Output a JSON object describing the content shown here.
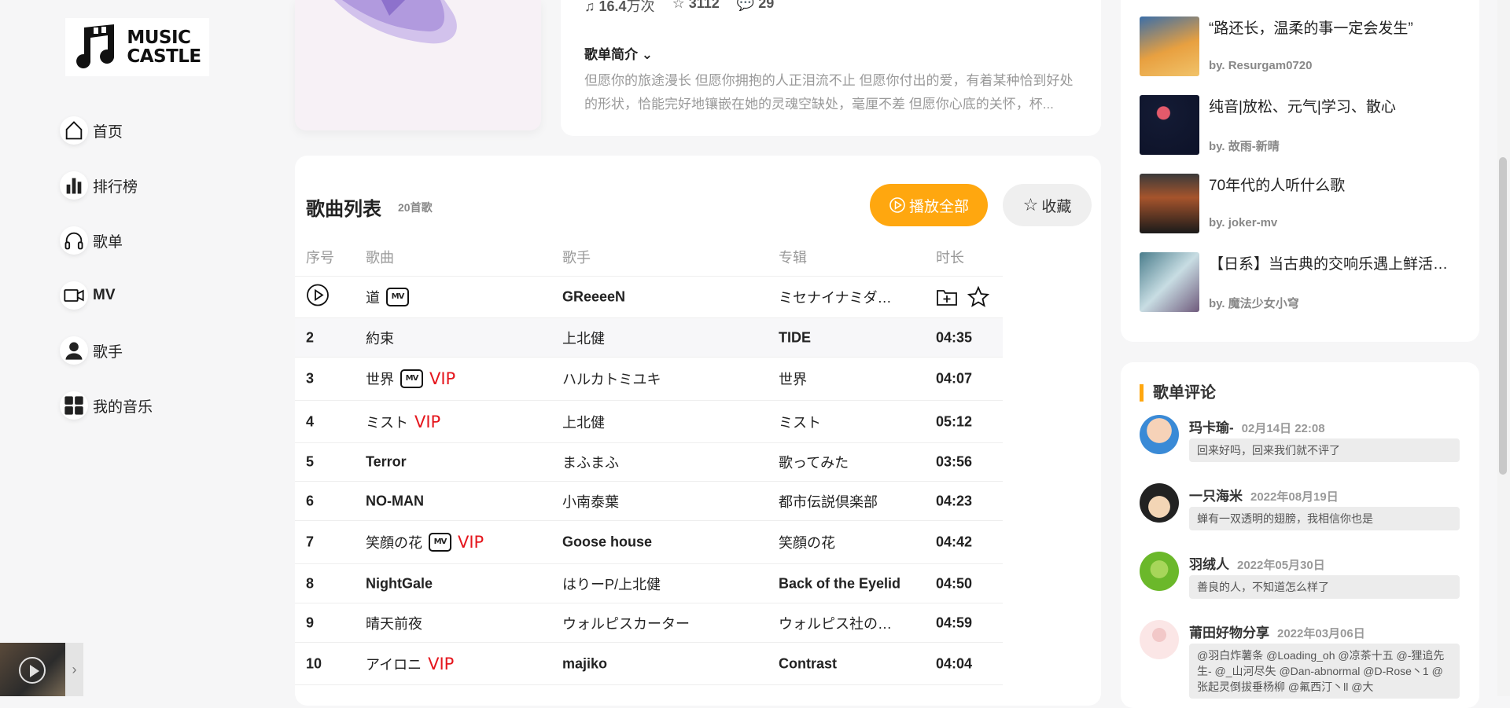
{
  "logo": {
    "line1": "MUSIC",
    "line2": "CASTLE"
  },
  "nav": [
    {
      "label": "首页",
      "icon": "home-icon"
    },
    {
      "label": "排行榜",
      "icon": "chart-icon"
    },
    {
      "label": "歌单",
      "icon": "headphones-icon"
    },
    {
      "label": "MV",
      "icon": "video-icon"
    },
    {
      "label": "歌手",
      "icon": "person-icon"
    },
    {
      "label": "我的音乐",
      "icon": "grid-icon"
    }
  ],
  "playlist": {
    "plays": "16.4",
    "plays_unit": "万次",
    "favs": "3112",
    "comments": "29",
    "intro_title": "歌单简介",
    "intro_text": "但愿你的旅途漫长 但愿你拥抱的人正泪流不止 但愿你付出的爱，有着某种恰到好处的形状，恰能完好地镶嵌在她的灵魂空缺处，毫厘不差 但愿你心底的关怀，杯..."
  },
  "songs": {
    "title": "歌曲列表",
    "count": "20首歌",
    "play_all": "播放全部",
    "collect": "收藏",
    "headers": [
      "序号",
      "歌曲",
      "歌手",
      "专辑",
      "时长"
    ],
    "rows": [
      {
        "no": "",
        "name": "道",
        "mv": true,
        "vip": false,
        "artist": "GReeeeN",
        "album": "ミセナイナミダハ…",
        "duration": ""
      },
      {
        "no": "2",
        "name": "約束",
        "mv": false,
        "vip": false,
        "artist": "上北健",
        "album": "TIDE",
        "duration": "04:35"
      },
      {
        "no": "3",
        "name": "世界",
        "mv": true,
        "vip": true,
        "artist": "ハルカトミユキ",
        "album": "世界",
        "duration": "04:07"
      },
      {
        "no": "4",
        "name": "ミスト",
        "mv": false,
        "vip": true,
        "artist": "上北健",
        "album": "ミスト",
        "duration": "05:12"
      },
      {
        "no": "5",
        "name": "Terror",
        "mv": false,
        "vip": false,
        "artist": "まふまふ",
        "album": "歌ってみた",
        "duration": "03:56"
      },
      {
        "no": "6",
        "name": "NO-MAN",
        "mv": false,
        "vip": false,
        "artist": "小南泰葉",
        "album": "都市伝説倶楽部",
        "duration": "04:23"
      },
      {
        "no": "7",
        "name": "笑顔の花",
        "mv": true,
        "vip": true,
        "artist": "Goose house",
        "album": "笑顔の花",
        "duration": "04:42"
      },
      {
        "no": "8",
        "name": "NightGale",
        "mv": false,
        "vip": false,
        "artist": "はりーP/上北健",
        "album": "Back of the Eyelid",
        "duration": "04:50"
      },
      {
        "no": "9",
        "name": "晴天前夜",
        "mv": false,
        "vip": false,
        "artist": "ウォルピスカーター",
        "album": "ウォルピス社の提…",
        "duration": "04:59"
      },
      {
        "no": "10",
        "name": "アイロニ",
        "mv": false,
        "vip": true,
        "artist": "majiko",
        "album": "Contrast",
        "duration": "04:04"
      }
    ],
    "mv_label": "MV",
    "vip_label": "VIP"
  },
  "recommend": [
    {
      "title": "“路还长，温柔的事一定会发生”",
      "by": "by. Resurgam0720"
    },
    {
      "title": "纯音|放松、元气|学习、散心",
      "by": "by. 故雨-新晴"
    },
    {
      "title": "70年代的人听什么歌",
      "by": "by. joker-mv"
    },
    {
      "title": "【日系】当古典的交响乐遇上鲜活…",
      "by": "by. 魔法少女小穹"
    }
  ],
  "comments": {
    "title": "歌单评论",
    "items": [
      {
        "name": "玛卡瑜-",
        "date": "02月14日 22:08",
        "text": "回来好吗，回来我们就不评了"
      },
      {
        "name": "一只海米",
        "date": "2022年08月19日",
        "text": "蝉有一双透明的翅膀，我相信你也是"
      },
      {
        "name": "羽绒人",
        "date": "2022年05月30日",
        "text": "善良的人，不知道怎么样了"
      },
      {
        "name": "莆田好物分享",
        "date": "2022年03月06日",
        "text": "@羽白炸薯条 @Loading_oh @凉茶十五 @-狸追先生- @_山河尽失 @Dan-abnormal @D-Rose丶1 @张起灵倒拔垂杨柳 @氟西汀丶ll @大"
      }
    ]
  },
  "colors": {
    "accent": "#ffa70f",
    "vip": "#e5161d"
  }
}
